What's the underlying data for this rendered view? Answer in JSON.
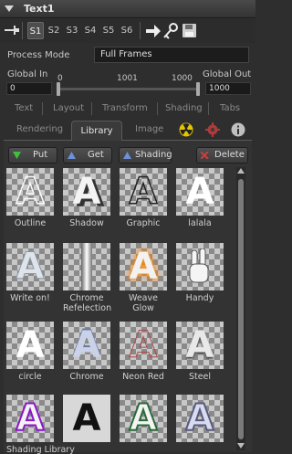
{
  "header": {
    "title": "Text1"
  },
  "slots": {
    "items": [
      "S1",
      "S2",
      "S3",
      "S4",
      "S5",
      "S6"
    ],
    "active": "S1"
  },
  "process_mode": {
    "label": "Process Mode",
    "value": "Full Frames"
  },
  "global_range": {
    "global_in_label": "Global In",
    "global_out_label": "Global Out",
    "global_in_value": "0",
    "global_out_value": "1000",
    "scale_start": "0",
    "scale_mid": "1001",
    "scale_end": "1000"
  },
  "tabs_row1": [
    "Text",
    "Layout",
    "Transform",
    "Shading",
    "Tabs"
  ],
  "tabs_row2": {
    "rendering": "Rendering",
    "library": "Library",
    "image": "Image"
  },
  "library_buttons": {
    "put": "Put",
    "get": "Get",
    "shading": "Shading",
    "delete": "Delete"
  },
  "presets": [
    {
      "name": "Outline"
    },
    {
      "name": "Shadow"
    },
    {
      "name": "Graphic"
    },
    {
      "name": "lalala"
    },
    {
      "name": "Write on!"
    },
    {
      "name": "Chrome Refelection"
    },
    {
      "name": "Weave Glow"
    },
    {
      "name": "Handy"
    },
    {
      "name": "circle"
    },
    {
      "name": "Chrome"
    },
    {
      "name": "Neon Red"
    },
    {
      "name": "Steel"
    },
    {
      "name": "Shading Library"
    },
    {
      "name": ""
    },
    {
      "name": ""
    },
    {
      "name": ""
    }
  ],
  "colors": {
    "accent": "#2a6fd6",
    "panel": "#2e2e2e",
    "put_icon": "#3fbf3f",
    "get_icon": "#6f8fd8",
    "delete_icon": "#c84040"
  }
}
